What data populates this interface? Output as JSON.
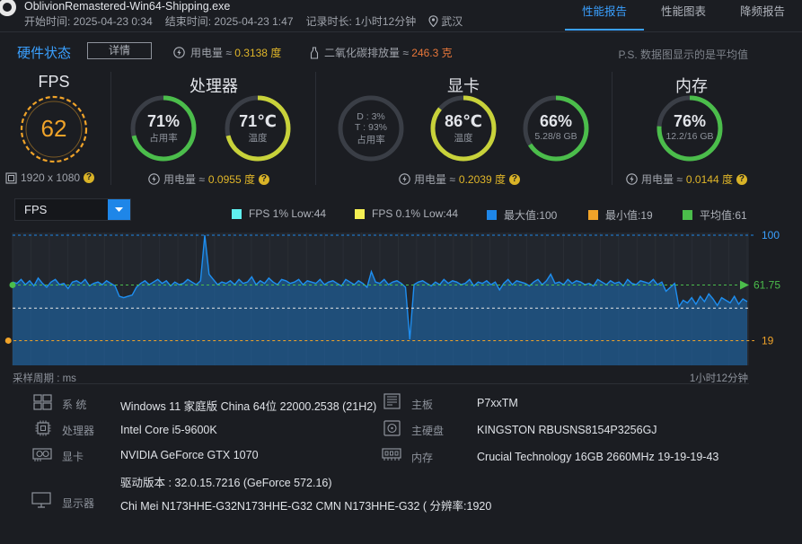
{
  "header": {
    "title": "OblivionRemastered-Win64-Shipping.exe",
    "start_label": "开始时间: 2025-04-23 0:34",
    "end_label": "结束时间: 2025-04-23 1:47",
    "duration_label": "记录时长: 1小时12分钟",
    "location": "武汉",
    "tabs": [
      "性能报告",
      "性能图表",
      "降频报告"
    ],
    "active_tab": "性能报告"
  },
  "status": {
    "title": "硬件状态",
    "details_button": "详情",
    "power_label": "用电量 ≈ ",
    "power_value": "0.3138 度",
    "co2_label": "二氧化碳排放量 ≈ ",
    "co2_value": "246.3 克",
    "note": "P.S. 数据图显示的是平均值"
  },
  "gauges": {
    "fps": {
      "title": "FPS",
      "value": "62",
      "resolution": "1920 x 1080"
    },
    "cpu": {
      "title": "处理器",
      "usage_value": "71%",
      "usage_label": "占用率",
      "usage_fraction": 0.71,
      "temp_value": "71℃",
      "temp_label": "温度",
      "temp_fraction": 0.71,
      "power_label": "用电量 ≈ ",
      "power_value": "0.0955 度"
    },
    "gpu": {
      "title": "显卡",
      "dt_line1": "D : 3%",
      "dt_line2": "T : 93%",
      "dt_label": "占用率",
      "temp_value": "86℃",
      "temp_label": "温度",
      "temp_fraction": 0.86,
      "vram_value": "66%",
      "vram_label": "5.28/8 GB",
      "vram_fraction": 0.66,
      "power_label": "用电量 ≈ ",
      "power_value": "0.2039 度"
    },
    "mem": {
      "title": "内存",
      "usage_value": "76%",
      "usage_label": "12.2/16 GB",
      "usage_fraction": 0.76,
      "power_label": "用电量 ≈ ",
      "power_value": "0.0144 度"
    }
  },
  "chart_controls": {
    "metric": "FPS",
    "legend": [
      {
        "label": "FPS 1% Low:44",
        "color": "#5ff0ef"
      },
      {
        "label": "FPS 0.1% Low:44",
        "color": "#f4ef53"
      },
      {
        "label": "最大值:100",
        "color": "#1e86e8"
      },
      {
        "label": "最小值:19",
        "color": "#f0a329"
      },
      {
        "label": "平均值:61",
        "color": "#4bbd4b"
      }
    ],
    "sample_label": "采样周期 : ms",
    "duration_label": "1小时12分钟"
  },
  "chart_data": {
    "type": "area",
    "title": "",
    "xlabel": "",
    "ylabel": "",
    "ylim": [
      0,
      100
    ],
    "max_value": 100,
    "max_label": "100",
    "min_value": 19,
    "min_label": "19",
    "avg_value": 61.75,
    "avg_label": "61.75",
    "low1_value": 44,
    "low01_value": 44,
    "series": [
      {
        "values": [
          64,
          63,
          66,
          62,
          65,
          61,
          67,
          63,
          60,
          64,
          66,
          62,
          63,
          59,
          64,
          65,
          63,
          66,
          61,
          63,
          64,
          62,
          65,
          63,
          61,
          53,
          52,
          53,
          54,
          60,
          63,
          65,
          62,
          64,
          66,
          63,
          65,
          61,
          64,
          62,
          63,
          66,
          64,
          62,
          65,
          100,
          70,
          66,
          62,
          64,
          63,
          65,
          62,
          66,
          63,
          64,
          68,
          62,
          65,
          63,
          67,
          64,
          62,
          66,
          65,
          63,
          64,
          66,
          62,
          65,
          64,
          63,
          66,
          62,
          64,
          65,
          63,
          61,
          66,
          64,
          62,
          65,
          63,
          60,
          72,
          64,
          63,
          66,
          62,
          64,
          65,
          63,
          60,
          20,
          62,
          64,
          65,
          63,
          61,
          64,
          62,
          66,
          63,
          65,
          64,
          62,
          63,
          66,
          61,
          64,
          63,
          65,
          62,
          64,
          58,
          63,
          66,
          62,
          65,
          64,
          63,
          61,
          64,
          66,
          62,
          65,
          70,
          63,
          64,
          62,
          66,
          63,
          65,
          64,
          62,
          63,
          61,
          66,
          64,
          62,
          65,
          63,
          64,
          61,
          66,
          63,
          62,
          65,
          64,
          63,
          66,
          62,
          64,
          57,
          60,
          63,
          45,
          50,
          48,
          52,
          47,
          53,
          49,
          55,
          51,
          46,
          52,
          50,
          48,
          53,
          47,
          51,
          49
        ]
      }
    ]
  },
  "specs": {
    "os_label": "系    统",
    "os_value": "Windows 11 家庭版 China 64位 22000.2538 (21H2)",
    "cpu_label": "处理器",
    "cpu_value": "Intel Core i5-9600K",
    "gpu_label": "显卡",
    "gpu_value": "NVIDIA GeForce GTX 1070",
    "driver_value": "驱动版本 : 32.0.15.7216 (GeForce 572.16)",
    "board_label": "主板",
    "board_value": "P7xxTM",
    "disk_label": "主硬盘",
    "disk_value": "KINGSTON RBUSNS8154P3256GJ",
    "ram_label": "内存",
    "ram_value": "Crucial Technology 16GB 2660MHz 19-19-19-43",
    "monitor_label": "显示器",
    "monitor_value": "Chi Mei N173HHE-G32N173HHE-G32 CMN N173HHE-G32 ( 分辨率:1920"
  }
}
